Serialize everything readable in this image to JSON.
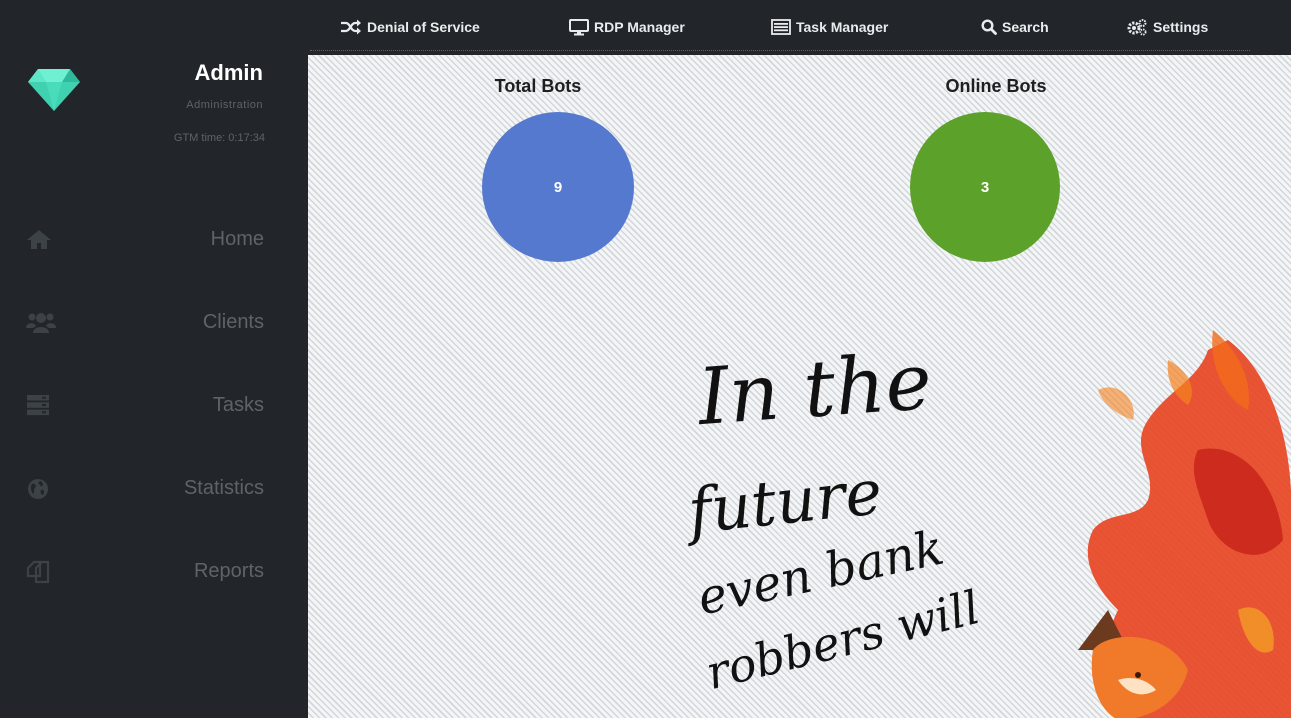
{
  "topnav": {
    "items": [
      {
        "label": "Denial of Service",
        "icon": "shuffle-icon"
      },
      {
        "label": "RDP Manager",
        "icon": "monitor-icon"
      },
      {
        "label": "Task Manager",
        "icon": "list-icon"
      },
      {
        "label": "Search",
        "icon": "search-icon"
      },
      {
        "label": "Settings",
        "icon": "gears-icon"
      }
    ]
  },
  "sidebar": {
    "admin_name": "Admin",
    "admin_role": "Administration",
    "gtm_time": "GTM time: 0:17:34",
    "items": [
      {
        "label": "Home",
        "icon": "home-icon"
      },
      {
        "label": "Clients",
        "icon": "users-icon"
      },
      {
        "label": "Tasks",
        "icon": "server-icon"
      },
      {
        "label": "Statistics",
        "icon": "globe-icon"
      },
      {
        "label": "Reports",
        "icon": "copy-icon"
      }
    ]
  },
  "stats": {
    "total_bots": {
      "title": "Total Bots",
      "value": "9",
      "color": "#5479cf"
    },
    "online_bots": {
      "title": "Online Bots",
      "value": "3",
      "color": "#5ba12a"
    }
  },
  "artwork": {
    "quote_lines": [
      "In the",
      "future",
      "even bank",
      "robbers will"
    ]
  },
  "colors": {
    "sidebar_bg": "#22262a",
    "logo_gem": "#3fd1b0"
  }
}
